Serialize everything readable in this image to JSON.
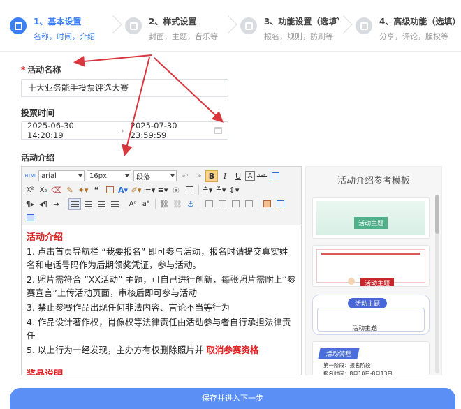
{
  "steps": [
    {
      "title": "1、基本设置",
      "sub": "名称，时间，介绍",
      "active": true
    },
    {
      "title": "2、样式设置",
      "sub": "封面，主题，音乐等",
      "active": false
    },
    {
      "title": "3、功能设置（选填）",
      "sub": "报名，规则，防刷等",
      "active": false
    },
    {
      "title": "4、高级功能（选填）",
      "sub": "分享，评论，版权等",
      "active": false
    }
  ],
  "form": {
    "name_label": "活动名称",
    "name_value": "十大业务能手投票评选大赛",
    "time_label": "投票时间",
    "start_time": "2025-06-30 14:20:19",
    "end_time": "2025-07-30 23:59:59",
    "range_sep": "→",
    "intro_label": "活动介绍"
  },
  "editor": {
    "font": "arial",
    "size": "16px",
    "paragraph": "段落",
    "html_label": "HTML",
    "content": {
      "heading": "活动介绍",
      "p1": "1. 点击首页导航栏 “我要报名” 即可参与活动，报名时请提交真实姓名和电话号码作为后期领奖凭证，参与活动。",
      "p2": "2. 照片需符合 “XX活动” 主题，可自己进行创新，每张照片需附上“参赛宣言”上传活动页面，审核后即可参与活动",
      "p3": "3. 禁止参赛作品出现任何非法内容、言论不当等行为",
      "p4": "4. 作品设计著作权，肖像权等法律责任由活动参与者自行承担法律责任",
      "p5_prefix": "5. 以上行为一经发现，主办方有权删除照片并 ",
      "p5_red": "取消参赛资格",
      "heading2": "奖品说明"
    }
  },
  "templates": {
    "title": "活动介绍参考模板",
    "card1_tag": "活动主题",
    "card2_tag": "活动主题",
    "card3_tab": "活动主题",
    "card3_text": "活动主题",
    "card4_tab": "活动流程",
    "card4_line1": "第一阶段：报名阶段",
    "card4_line2": "报名时间：8月10日-8月13日"
  },
  "save_button": "保存并进入下一步",
  "colors": {
    "accent": "#3b7ff5",
    "required": "#e02020",
    "button": "#5b8ff6",
    "annotation": "#d9363e"
  }
}
